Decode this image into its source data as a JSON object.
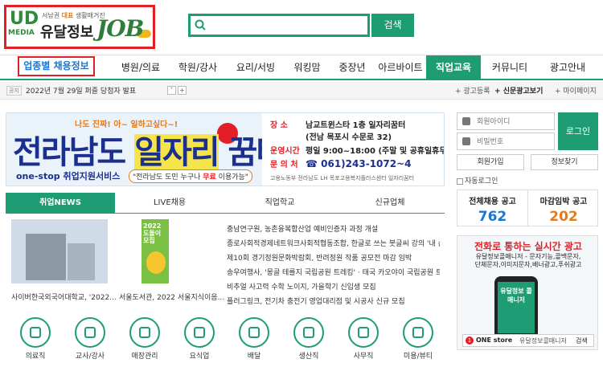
{
  "header": {
    "logo_tagline_prefix": "서남권",
    "logo_tagline_highlight": "대표",
    "logo_tagline_suffix": "생활매거진",
    "logo_ud": "UD",
    "logo_media": "MEDIA",
    "logo_name": "유달정보",
    "logo_job": "JOB",
    "search_placeholder": "",
    "search_button": "검색"
  },
  "nav": {
    "items": [
      "업종별 채용정보",
      "병원/의료",
      "학원/강사",
      "요리/서빙",
      "워킹맘",
      "중장년",
      "아르바이트",
      "직업교육",
      "커뮤니티",
      "광고안내"
    ],
    "active_index": 7
  },
  "notice": {
    "tag": "공지",
    "text": "2022년 7월 29일 퍼즐 당첨자 발표",
    "prev": "˅",
    "next": "+",
    "links": [
      "광고등록",
      "신문광고보기",
      "마이페이지"
    ]
  },
  "banner": {
    "top_text": "나도 진짜! 아~ 일하고싶다~!",
    "title_part1": "전라남도 ",
    "title_highlight": "일자리",
    "title_part2": " 꿈터",
    "sub1": "one-stop 취업지원서비스",
    "sub2_prefix": "\"전라남도 도민 누구나 ",
    "sub2_highlight": "무료",
    "sub2_suffix": " 이용가능\"",
    "rows": [
      {
        "k": "장    소",
        "v": "남교트윈스타 1층 일자리꿈터"
      },
      {
        "k": "",
        "v": "(전남 목포시 수문로 32)"
      },
      {
        "k": "운영시간",
        "v": "평일 9:00~18:00 (주말 및 공휴일휴무)"
      },
      {
        "k": "문 의 처",
        "v": "☎ 061)243-1072~4"
      }
    ],
    "logos": "고용노동부   전라남도   LH   목포고용복지플러스센터   일자리꿈터"
  },
  "login": {
    "id_placeholder": "회원아이디",
    "pw_placeholder": "비밀번호",
    "login_button": "로그인",
    "join_button": "회원가입",
    "find_button": "정보찾기",
    "auto_login": "자동로그인"
  },
  "stats": {
    "total_label": "전체채용 공고",
    "total_value": "762",
    "deadline_label": "마감임박 공고",
    "deadline_value": "202",
    "total_color": "#1976d2",
    "deadline_color": "#e47b1c"
  },
  "ad": {
    "title": "전화로 통하는 실시간 광고",
    "sub_line1": "유달정보콜매니저 - 문자기능,콜백문자,",
    "sub_line2": "단체문자,이미지문자,배너광고,푸쉬광고",
    "phone_text": "유달정보 콜매니저",
    "store_number": "1",
    "store_name": "ONE store",
    "store_query": "유달정보콜매니저",
    "store_search": "검색"
  },
  "tabs": [
    "취업NEWS",
    "LIVE채용",
    "직업학교",
    "신규업체"
  ],
  "thumbs": {
    "caption1": "사이버한국외국어대학교, '2022...",
    "caption2": "서울도서관, 2022 서울지식이음...",
    "poster_text": "2022 도돌이 모집"
  },
  "news": [
    "충남연구원, 농촌융복합산업 예비인증자 과정 개설",
    "종로사회적경제네트워크사회적협동조합, 한글로 쓰는 붓글씨 강의 '내 손...",
    "제10회 경기정원문화박람회, 반려정원 작품 공모전 마감 임박",
    "송우여행사, '몽골 테를지 국립공원 트레킹' · 태국 카오야이 국립공원 트레...",
    "비추얼 사고력 수학 노이지, 가을학기 신입생 모집",
    "플러그링크, 전기차 충전기 영업대리점 및 시공사 신규 모집"
  ],
  "categories": [
    "의료직",
    "교사/강사",
    "매장관리",
    "요식업",
    "배달",
    "생산직",
    "사무직",
    "미용/뷰티"
  ],
  "colors": {
    "accent": "#1e9d74",
    "highlight": "#e41e26",
    "navy": "#1b2f8f"
  }
}
